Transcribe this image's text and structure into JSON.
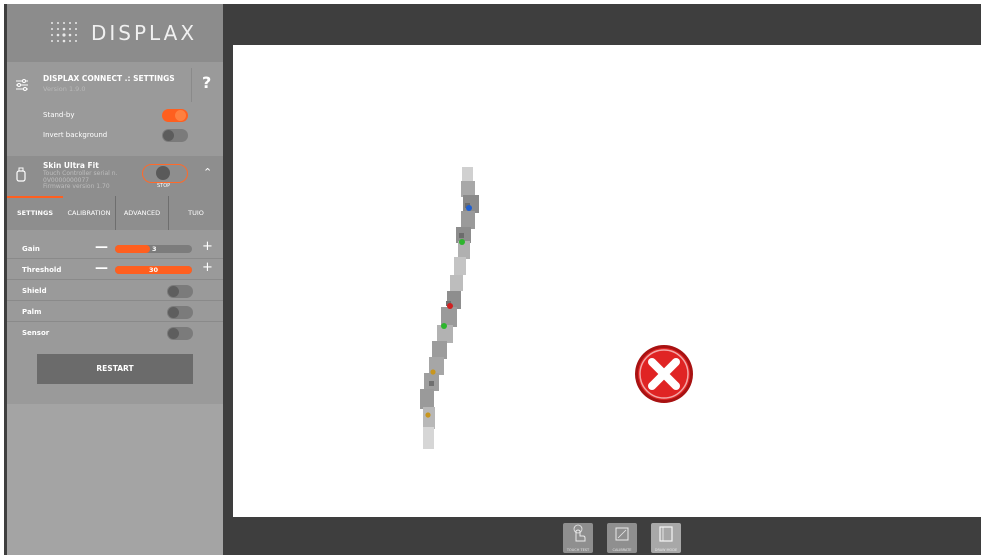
{
  "logo": {
    "text": "DISPLAX",
    "icon": "dot-grid-logo"
  },
  "header": {
    "title": "DISPLAX CONNECT .: SETTINGS",
    "version": "Version 1.9.0",
    "help_label": "?"
  },
  "global_toggles": [
    {
      "label": "Stand-by",
      "on": true
    },
    {
      "label": "Invert background",
      "on": false
    }
  ],
  "device": {
    "name": "Skin Ultra Fit",
    "line1": "Touch Controller serial n.",
    "line2": "0V0000000077",
    "line3": "Firmware version 1.70",
    "stop_label": "STOP"
  },
  "tabs": [
    {
      "label": "SETTINGS",
      "active": true
    },
    {
      "label": "CALIBRATION",
      "active": false
    },
    {
      "label": "ADVANCED",
      "active": false
    },
    {
      "label": "TUIO",
      "active": false
    }
  ],
  "settings": {
    "gain": {
      "label": "Gain",
      "value": "3",
      "fraction": 0.45
    },
    "threshold": {
      "label": "Threshold",
      "value": "30",
      "fraction": 1.0
    },
    "switches": [
      {
        "label": "Shield",
        "on": false
      },
      {
        "label": "Palm",
        "on": false
      },
      {
        "label": "Sensor",
        "on": false
      }
    ],
    "minus_label": "—",
    "plus_label": "+",
    "restart_label": "RESTART"
  },
  "canvas": {
    "status_icon": "error-x-icon",
    "touch_point_colors": [
      "#1f5fd0",
      "#2db52d",
      "#d02020",
      "#2db52d",
      "#c8961e",
      "#c8961e"
    ]
  },
  "bottom_toolbar": [
    {
      "label": "TOUCH TEST",
      "icon": "touch-hand-icon"
    },
    {
      "label": "CALIBRATE",
      "icon": "calibrate-icon"
    },
    {
      "label": "DRAW MODE",
      "icon": "draw-panel-icon"
    }
  ],
  "colors": {
    "accent": "#ff5f1f",
    "sidebar": "#9a9a9a",
    "frame": "#3e3e3e"
  }
}
